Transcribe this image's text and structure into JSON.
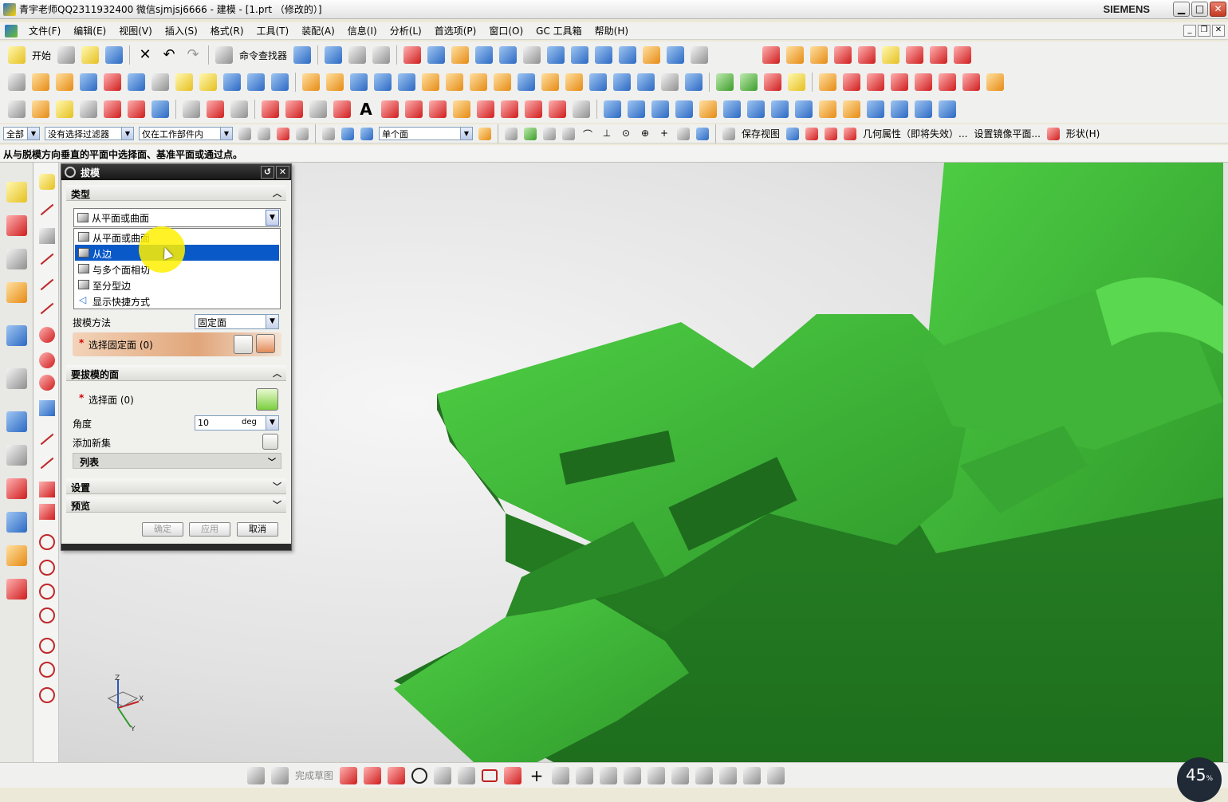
{
  "window": {
    "title": "青宇老师QQ2311932400 微信sjmjsj6666 - 建模 - [1.prt （修改的）]",
    "brand": "SIEMENS",
    "min": "▁",
    "max": "□",
    "close": "✕"
  },
  "menu": [
    "文件(F)",
    "编辑(E)",
    "视图(V)",
    "插入(S)",
    "格式(R)",
    "工具(T)",
    "装配(A)",
    "信息(I)",
    "分析(L)",
    "首选项(P)",
    "窗口(O)",
    "GC 工具箱",
    "帮助(H)"
  ],
  "toolbar": {
    "start_label": "开始",
    "command_finder": "命令查找器"
  },
  "selection_bar": {
    "filter_type": "全部",
    "selection_filter": "没有选择过滤器",
    "scope": "仅在工作部件内",
    "face_rule": "单个面",
    "save_view": "保存视图",
    "geometry_props": "几何属性（即将失效）...",
    "mirror_plane": "设置镜像平面...",
    "shape_menu": "形状(H)"
  },
  "status": {
    "cue": "从与脱模方向垂直的平面中选择面、基准平面或通过点。"
  },
  "dialog": {
    "title": "拔模",
    "type_group": "类型",
    "type_value": "从平面或曲面",
    "type_options": [
      "从平面或曲面",
      "从边",
      "与多个面相切",
      "至分型边",
      "显示快捷方式"
    ],
    "draft_method_label": "拔模方法",
    "draft_method_value": "固定面",
    "select_stationary": "选择固定面 (0)",
    "faces_group": "要拔模的面",
    "select_face": "选择面 (0)",
    "angle_label": "角度",
    "angle_value": "10",
    "angle_unit": "deg",
    "add_new_set": "添加新集",
    "list_label": "列表",
    "settings_group": "设置",
    "preview_group": "预览",
    "ok": "确定",
    "apply": "应用",
    "cancel": "取消"
  },
  "bottombar": {
    "finish_sketch": "完成草图"
  },
  "triad": {
    "x": "X",
    "y": "Y",
    "z": "Z"
  },
  "zoom_badge": {
    "value": "45",
    "unit": "%"
  },
  "colors": {
    "model_green": "#3db53a",
    "selection_blue": "#0a59c8",
    "highlight_yellow": "#fff000"
  }
}
